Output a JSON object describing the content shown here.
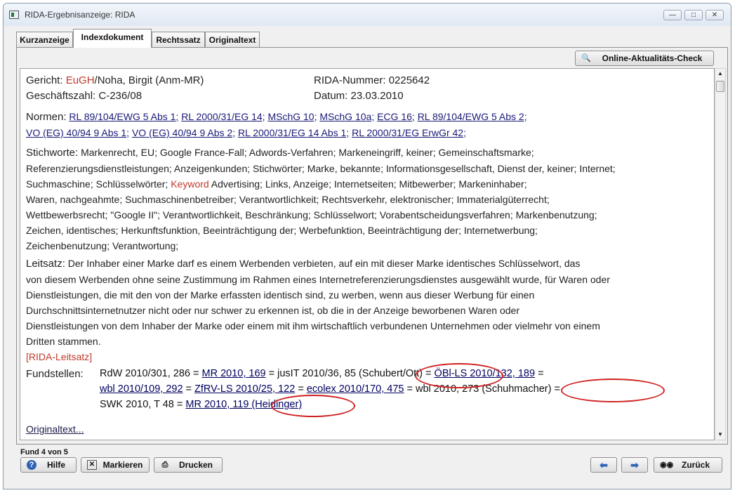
{
  "window": {
    "title": "RIDA-Ergebnisanzeige: RIDA"
  },
  "tabs": [
    "Kurzanzeige",
    "Indexdokument",
    "Rechtssatz",
    "Originaltext"
  ],
  "toolbar": {
    "online_check": "Online-Aktualitäts-Check"
  },
  "doc": {
    "gericht_label": "Gericht:",
    "gericht_court": "EuGH",
    "gericht_rest": "/Noha, Birgit (Anm-MR)",
    "rida_label": "RIDA-Nummer:",
    "rida_value": "0225642",
    "gz_label": "Geschäftszahl:",
    "gz_value": "C-236/08",
    "datum_label": "Datum:",
    "datum_value": "23.03.2010",
    "normen_label": "Normen:",
    "normen_line1": [
      "RL 89/104/EWG 5 Abs 1;",
      "RL 2000/31/EG 14;",
      "MSchG 10;",
      "MSchG 10a;",
      "ECG 16;",
      "RL 89/104/EWG 5 Abs 2;"
    ],
    "normen_line2": [
      "VO (EG) 40/94 9 Abs 1;",
      "VO (EG) 40/94 9 Abs 2;",
      "RL 2000/31/EG 14 Abs 1;",
      "RL 2000/31/EG ErwGr 42;"
    ],
    "stichworte_label": "Stichworte:",
    "stichworte_l1": "Markenrecht, EU;  Google France-Fall;  Adwords-Verfahren;  Markeneingriff, keiner;  Gemeinschaftsmarke;",
    "stichworte_l2": "Referenzierungsdienstleistungen;  Anzeigenkunden;  Stichwörter;  Marke, bekannte;  Informationsgesellschaft, Dienst der, keiner;  Internet;",
    "stichworte_l3a": "Suchmaschine;  Schlüsselwörter;",
    "stichworte_l3_keyword": "Keyword",
    "stichworte_l3b": "Advertising;  Links, Anzeige;  Internetseiten;  Mitbewerber;  Markeninhaber;",
    "stichworte_l4": "Waren, nachgeahmte;  Suchmaschinenbetreiber;  Verantwortlichkeit;  Rechtsverkehr, elektronischer;  Immaterialgüterrecht;",
    "stichworte_l5": "Wettbewerbsrecht;  \"Google II\";  Verantwortlichkeit, Beschränkung;  Schlüsselwort;  Vorabentscheidungsverfahren;  Markenbenutzung;",
    "stichworte_l6": "Zeichen, identisches;  Herkunftsfunktion, Beeinträchtigung der;  Werbefunktion, Beeinträchtigung der;  Internetwerbung;",
    "stichworte_l7": "Zeichenbenutzung;  Verantwortung;",
    "leitsatz_label": "Leitsatz:",
    "leitsatz_l1": "Der Inhaber einer Marke darf es einem Werbenden verbieten, auf ein mit dieser Marke identisches Schlüsselwort, das",
    "leitsatz_l2": "von diesem Werbenden ohne seine Zustimmung im Rahmen eines Internetreferenzierungsdienstes ausgewählt wurde, für Waren oder",
    "leitsatz_l3": "Dienstleistungen, die mit den von der Marke erfassten identisch sind, zu werben, wenn aus dieser Werbung für einen",
    "leitsatz_l4": "Durchschnittsinternetnutzer nicht oder nur schwer zu erkennen ist, ob die in der Anzeige beworbenen Waren oder",
    "leitsatz_l5": "Dienstleistungen von dem Inhaber der Marke oder einem mit ihm wirtschaftlich verbundenen Unternehmen oder vielmehr von einem",
    "leitsatz_l6": "Dritten stammen.",
    "leitsatz_source": "[RIDA-Leitsatz]",
    "fund_label": "Fundstellen:",
    "fund_l1_a": "RdW 2010/301, 286 =",
    "fund_l1_b": "MR 2010, 169",
    "fund_l1_c": "= jusIT 2010/36, 85 (Schubert/Ott) =",
    "fund_l1_d": "ÖBl-LS 2010/132, 189",
    "fund_l1_e": "=",
    "fund_l2_a": "wbl 2010/109, 292",
    "fund_l2_b": "=",
    "fund_l2_c": "ZfRV-LS 2010/25, 122",
    "fund_l2_d": "=",
    "fund_l2_e": "ecolex 2010/170, 475",
    "fund_l2_f": "= wbl 2010, 273 (Schuhmacher) =",
    "fund_l3_a": "SWK 2010, T 48 =",
    "fund_l3_b": "MR 2010, 119 (Heidinger)",
    "originaltext_link": "Originaltext..."
  },
  "status": {
    "text": "Fund 4 von 5"
  },
  "buttons": {
    "hilfe": "Hilfe",
    "markieren": "Markieren",
    "drucken": "Drucken",
    "zurueck": "Zurück"
  },
  "accent": {
    "red": "#c0392b",
    "link": "#1a1a7a",
    "annotation": "#d02020"
  }
}
